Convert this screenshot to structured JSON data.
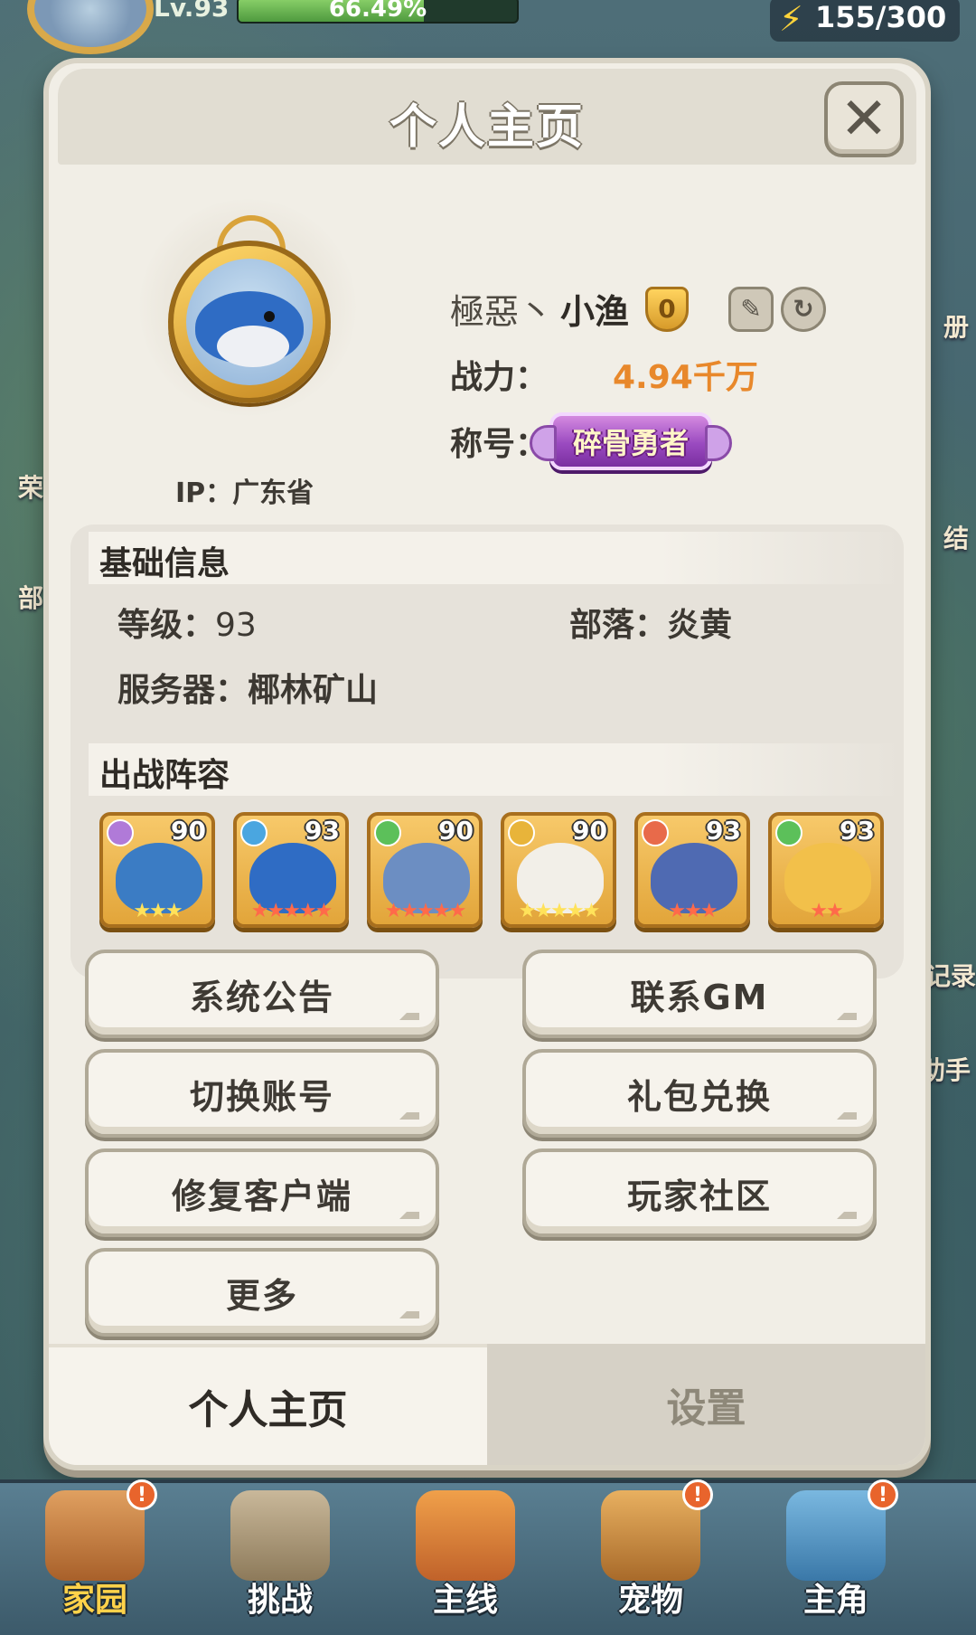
{
  "hud": {
    "level": "Lv.93",
    "exp_percent": "66.49%",
    "exp_fraction": 0.6649,
    "energy": "155/300"
  },
  "scene_side_labels": [
    "荣",
    "部",
    "册",
    "结",
    "记录",
    "助手"
  ],
  "dialog": {
    "title": "个人主页",
    "close_icon": "close-icon"
  },
  "profile": {
    "ip_label": "IP：广东省",
    "name_part1": "極惡丶",
    "name_part2": "小渔",
    "rank_badge": "0",
    "power_label": "战力：",
    "power_value": "4.94千万",
    "title_label": "称号：",
    "title_badge": "碎骨勇者"
  },
  "basic_info": {
    "section_title": "基础信息",
    "level_label": "等级：",
    "level_value": "93",
    "tribe_label": "部落：",
    "tribe_value": "炎黄",
    "server_label": "服务器：",
    "server_value": "椰林矿山"
  },
  "lineup": {
    "section_title": "出战阵容",
    "pets": [
      {
        "level": "90",
        "element_color": "#b07ad8",
        "body_color": "#3b7cc4",
        "stars": "★★★",
        "star_color": "#ffe25a"
      },
      {
        "level": "93",
        "element_color": "#4aa6e0",
        "body_color": "#2f6cc4",
        "stars": "★★★★★",
        "star_color": "#ff6a4a"
      },
      {
        "level": "90",
        "element_color": "#5cc05a",
        "body_color": "#6c8ec2",
        "stars": "★★★★★",
        "star_color": "#ff6a4a"
      },
      {
        "level": "90",
        "element_color": "#e8b43a",
        "body_color": "#f2efe8",
        "stars": "★★★★★",
        "star_color": "#ffe25a"
      },
      {
        "level": "93",
        "element_color": "#e86a4a",
        "body_color": "#4f6ab2",
        "stars": "★★★",
        "star_color": "#ff6a4a"
      },
      {
        "level": "93",
        "element_color": "#5cc05a",
        "body_color": "#f2c04a",
        "stars": "★★",
        "star_color": "#ff6a4a"
      }
    ]
  },
  "actions": {
    "system_notice": "系统公告",
    "contact_gm": "联系GM",
    "switch_account": "切换账号",
    "gift_redeem": "礼包兑换",
    "repair_client": "修复客户端",
    "player_community": "玩家社区",
    "more": "更多"
  },
  "dialog_tabs": {
    "profile": "个人主页",
    "settings": "设置"
  },
  "bottom_nav": [
    {
      "label": "家园",
      "active": true,
      "badge": "!"
    },
    {
      "label": "挑战",
      "active": false,
      "badge": ""
    },
    {
      "label": "主线",
      "active": false,
      "badge": ""
    },
    {
      "label": "宠物",
      "active": false,
      "badge": "!"
    },
    {
      "label": "主角",
      "active": false,
      "badge": "!"
    }
  ]
}
